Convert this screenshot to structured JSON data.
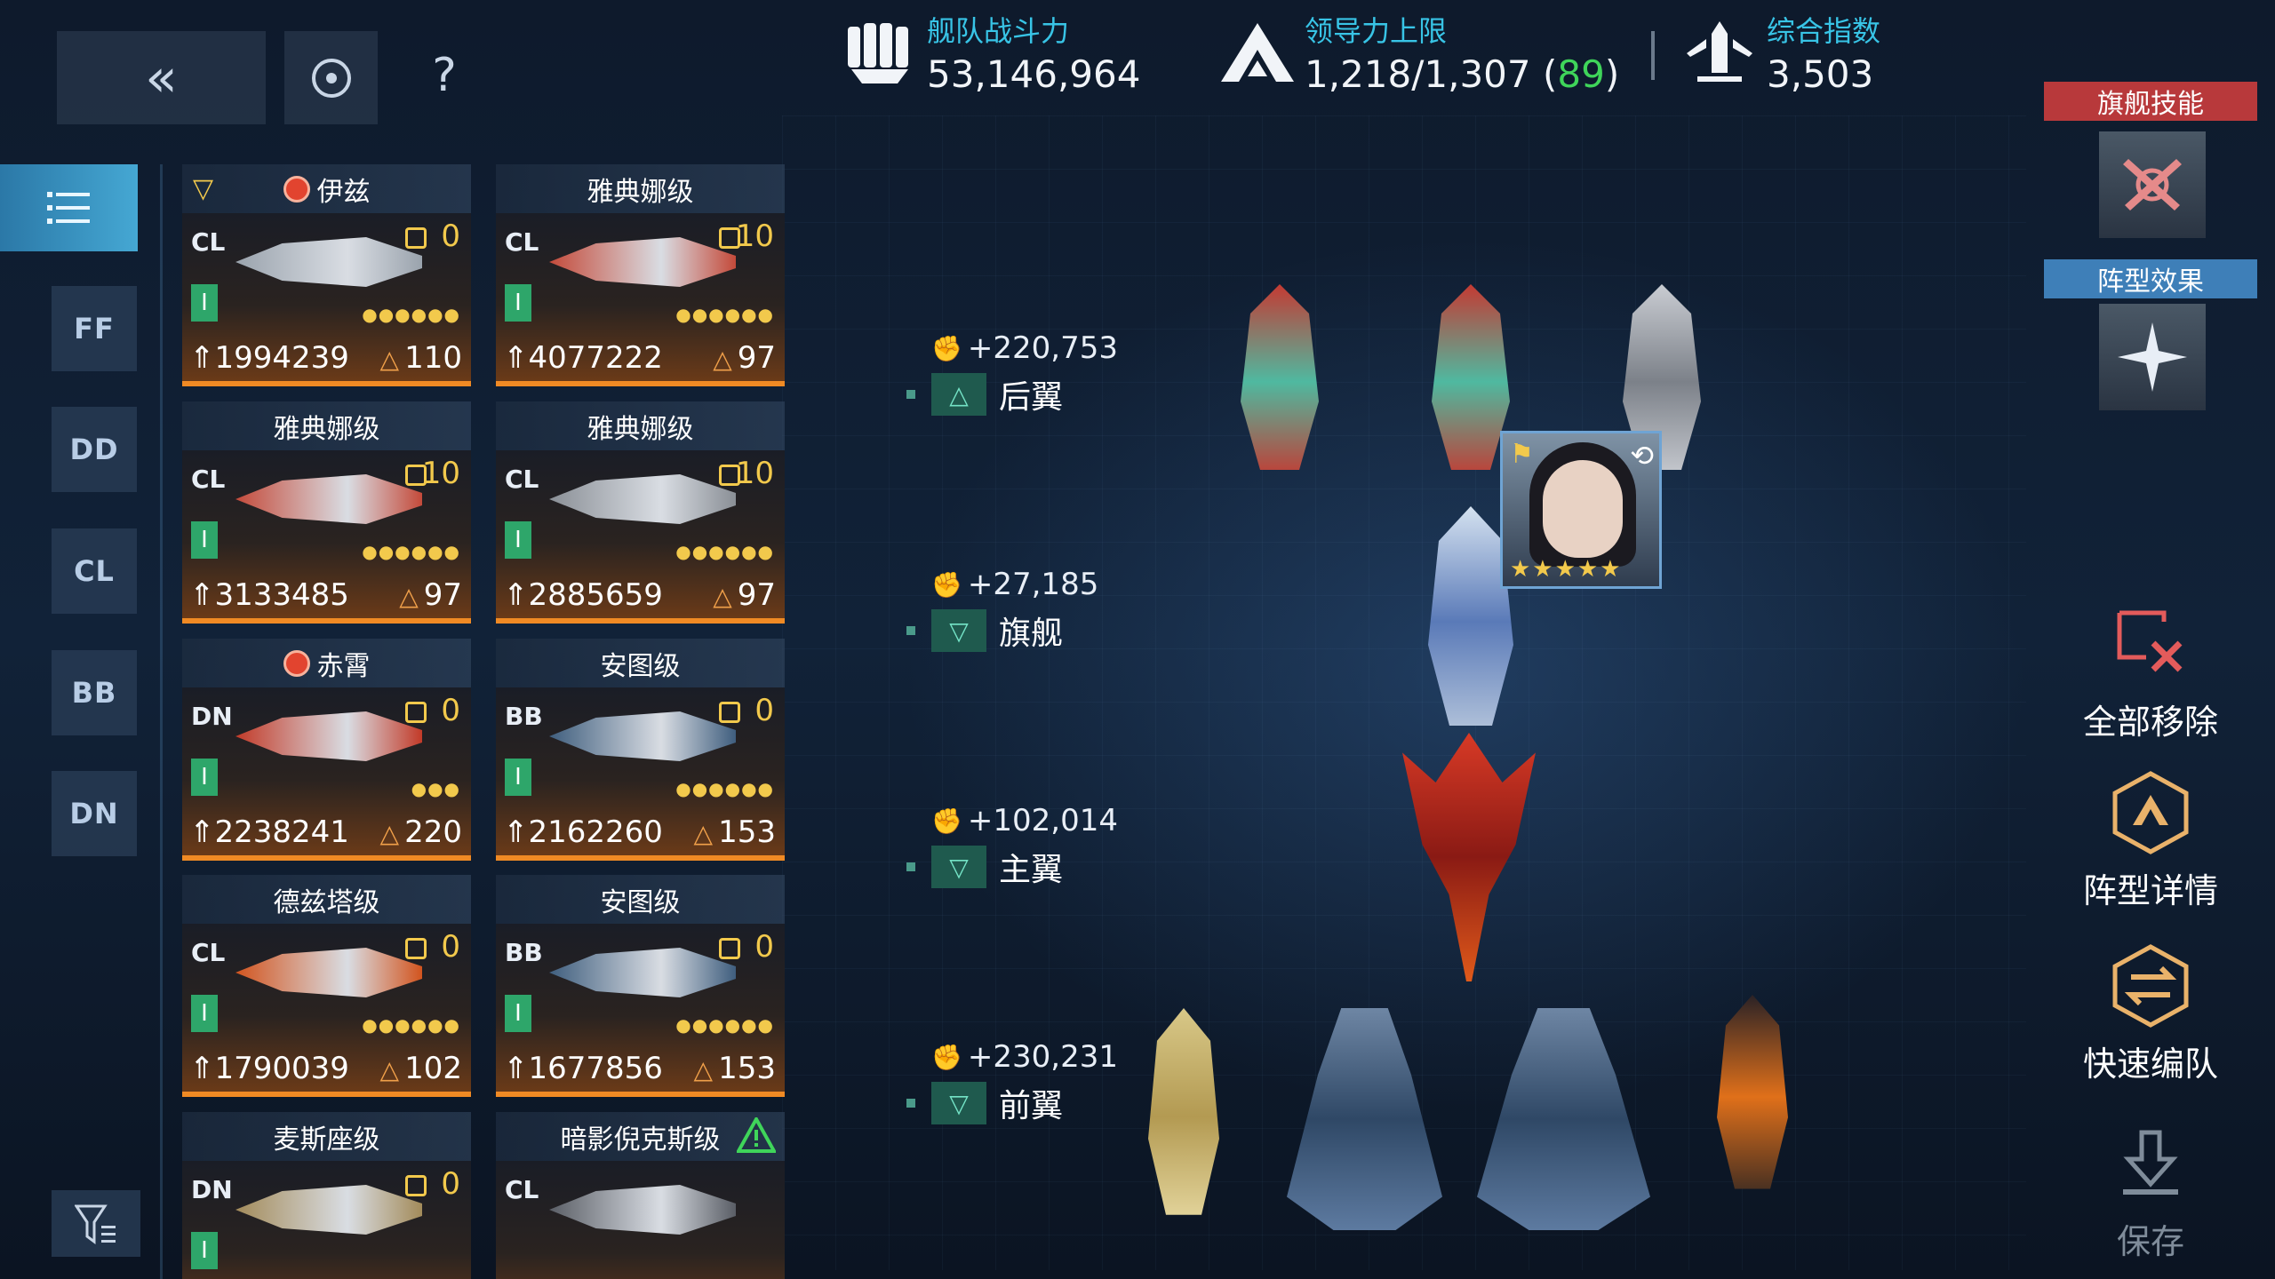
{
  "header": {
    "back_icon": "double-chevron-left-icon",
    "target_icon": "target-icon",
    "help_label": "?",
    "fleet_power": {
      "label": "舰队战斗力",
      "value": "53,146,964",
      "icon": "fist-icon"
    },
    "leadership": {
      "label": "领导力上限",
      "value": "1,218/1,307 (",
      "bonus": "89",
      "close": ")",
      "icon": "chevron-up-icon"
    },
    "composite": {
      "label": "综合指数",
      "value": "3,503",
      "icon": "rocket-icon"
    }
  },
  "left_rail": {
    "tabs": [
      "FF",
      "DD",
      "CL",
      "BB",
      "DN"
    ],
    "active_icon": "list-icon",
    "filter_icon": "filter-icon"
  },
  "ship_cards": [
    {
      "name": "伊兹",
      "class": "CL",
      "tier": "I",
      "level": "0",
      "pips": "●●●●●●",
      "power": "1994239",
      "command": "110",
      "color": "#9aa3ad",
      "has_red_icon": true,
      "has_flag_icon": true
    },
    {
      "name": "雅典娜级",
      "class": "CL",
      "tier": "I",
      "level": "10",
      "pips": "●●●●●●",
      "power": "4077222",
      "command": "97",
      "color": "#c44a3a"
    },
    {
      "name": "雅典娜级",
      "class": "CL",
      "tier": "I",
      "level": "10",
      "pips": "●●●●●●",
      "power": "3133485",
      "command": "97",
      "color": "#c44a3a"
    },
    {
      "name": "雅典娜级",
      "class": "CL",
      "tier": "I",
      "level": "10",
      "pips": "●●●●●●",
      "power": "2885659",
      "command": "97",
      "color": "#8a8f96"
    },
    {
      "name": "赤霄",
      "class": "DN",
      "tier": "I",
      "level": "0",
      "pips": "●●●",
      "power": "2238241",
      "command": "220",
      "color": "#c23a28",
      "has_red_icon": true
    },
    {
      "name": "安图级",
      "class": "BB",
      "tier": "I",
      "level": "0",
      "pips": "●●●●●●",
      "power": "2162260",
      "command": "153",
      "color": "#3f5e7e"
    },
    {
      "name": "德兹塔级",
      "class": "CL",
      "tier": "I",
      "level": "0",
      "pips": "●●●●●●",
      "power": "1790039",
      "command": "102",
      "color": "#d2541e"
    },
    {
      "name": "安图级",
      "class": "BB",
      "tier": "I",
      "level": "0",
      "pips": "●●●●●●",
      "power": "1677856",
      "command": "153",
      "color": "#3f5e7e"
    },
    {
      "name": "麦斯座级",
      "class": "DN",
      "tier": "I",
      "level": "0",
      "pips": "",
      "power": "",
      "command": "",
      "color": "#a38b5a"
    },
    {
      "name": "暗影倪克斯级",
      "class": "CL",
      "tier": "",
      "level": "",
      "pips": "",
      "power": "",
      "command": "",
      "color": "#5a5e66",
      "warning": true
    }
  ],
  "formation_rows": [
    {
      "power": "+220,753",
      "name": "后翼",
      "icon": "chevron-up-icon"
    },
    {
      "power": "+27,185",
      "name": "旗舰",
      "icon": "flagship-chevron-icon"
    },
    {
      "power": "+102,014",
      "name": "主翼",
      "icon": "double-chevron-down-icon"
    },
    {
      "power": "+230,231",
      "name": "前翼",
      "icon": "chevron-down-icon"
    }
  ],
  "commander": {
    "stars": "★★★★★",
    "flag_icon": "flag-icon",
    "swap_icon": "swap-icon"
  },
  "right_panel": {
    "flagship_skill": "旗舰技能",
    "formation_effect": "阵型效果",
    "remove_all": "全部移除",
    "formation_detail": "阵型详情",
    "quick_form": "快速编队",
    "save": "保存"
  },
  "colors": {
    "accent_cyan": "#38c4e6",
    "accent_orange": "#f08a24",
    "skill_red": "#b8393b",
    "effect_blue": "#3e7fb8",
    "green": "#3fd55a"
  }
}
